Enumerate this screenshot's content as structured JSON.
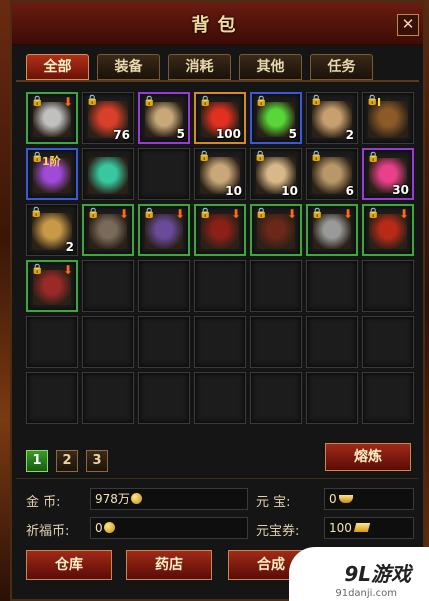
{
  "window": {
    "title": "背包",
    "close_glyph": "✕"
  },
  "tabs": [
    {
      "label": "全部",
      "active": true
    },
    {
      "label": "装备",
      "active": false
    },
    {
      "label": "消耗",
      "active": false
    },
    {
      "label": "其他",
      "active": false
    },
    {
      "label": "任务",
      "active": false
    }
  ],
  "grid": {
    "columns": 7,
    "rows": 6
  },
  "items": [
    {
      "name": "ornate-sword-icon",
      "quality": "green",
      "locked": true,
      "upgrade": true,
      "count": "",
      "badge": "",
      "color": "#c0c0c0"
    },
    {
      "name": "red-potion-vial-icon",
      "quality": "none",
      "locked": true,
      "upgrade": false,
      "count": "76",
      "badge": "",
      "color": "#d8402a"
    },
    {
      "name": "treasure-map-icon",
      "quality": "purple",
      "locked": true,
      "upgrade": false,
      "count": "5",
      "badge": "",
      "color": "#c8a878"
    },
    {
      "name": "red-gem-chest-icon",
      "quality": "orange",
      "locked": true,
      "upgrade": false,
      "count": "100",
      "badge": "",
      "color": "#e03020"
    },
    {
      "name": "green-crystal-icon",
      "quality": "blue",
      "locked": true,
      "upgrade": false,
      "count": "5",
      "badge": "",
      "color": "#58d838"
    },
    {
      "name": "treasure-map-icon",
      "quality": "none",
      "locked": true,
      "upgrade": false,
      "count": "2",
      "badge": "",
      "color": "#c8a070"
    },
    {
      "name": "treasure-chest-icon",
      "quality": "none",
      "locked": true,
      "upgrade": false,
      "count": "",
      "badge": "I",
      "color": "#8a5a28"
    },
    {
      "name": "purple-whip-icon",
      "quality": "blue",
      "locked": true,
      "upgrade": false,
      "count": "",
      "badge": "1阶",
      "color": "#a04ad8"
    },
    {
      "name": "exp-orb-icon",
      "quality": "none",
      "locked": false,
      "upgrade": false,
      "count": "",
      "badge": "",
      "color": "#38c8a0"
    },
    {
      "name": "",
      "quality": "none",
      "locked": false,
      "upgrade": false,
      "count": "",
      "badge": "",
      "color": ""
    },
    {
      "name": "scroll-bundle-icon",
      "quality": "none",
      "locked": true,
      "upgrade": false,
      "count": "10",
      "badge": "",
      "color": "#c8a878"
    },
    {
      "name": "scroll-bundle-icon",
      "quality": "none",
      "locked": true,
      "upgrade": false,
      "count": "10",
      "badge": "",
      "color": "#d8b888"
    },
    {
      "name": "parchment-scroll-icon",
      "quality": "none",
      "locked": true,
      "upgrade": false,
      "count": "6",
      "badge": "",
      "color": "#b89868"
    },
    {
      "name": "heart-potion-icon",
      "quality": "purple",
      "locked": true,
      "upgrade": false,
      "count": "30",
      "badge": "",
      "color": "#e8408a"
    },
    {
      "name": "skill-book-icon",
      "quality": "none",
      "locked": true,
      "upgrade": false,
      "count": "2",
      "badge": "",
      "color": "#c89a48"
    },
    {
      "name": "helmet-icon",
      "quality": "green",
      "locked": true,
      "upgrade": true,
      "count": "",
      "badge": "",
      "color": "#7a6a5a"
    },
    {
      "name": "amulet-icon",
      "quality": "green",
      "locked": true,
      "upgrade": true,
      "count": "",
      "badge": "",
      "color": "#6a4a9a"
    },
    {
      "name": "armor-robe-icon",
      "quality": "green",
      "locked": true,
      "upgrade": true,
      "count": "",
      "badge": "",
      "color": "#8a2018"
    },
    {
      "name": "boots-icon",
      "quality": "green",
      "locked": true,
      "upgrade": true,
      "count": "",
      "badge": "",
      "color": "#6a2818"
    },
    {
      "name": "ornate-sword-icon",
      "quality": "green",
      "locked": true,
      "upgrade": true,
      "count": "",
      "badge": "",
      "color": "#9a9a9a"
    },
    {
      "name": "ring-icon",
      "quality": "green",
      "locked": true,
      "upgrade": true,
      "count": "",
      "badge": "",
      "color": "#b82a18"
    },
    {
      "name": "dagger-icon",
      "quality": "green",
      "locked": true,
      "upgrade": true,
      "count": "",
      "badge": "",
      "color": "#9a2a28"
    }
  ],
  "pager": {
    "pages": [
      "1",
      "2",
      "3"
    ],
    "active_index": 0
  },
  "buttons": {
    "smelt": "熔炼",
    "warehouse": "仓库",
    "pharmacy": "药店",
    "compose": "合成"
  },
  "stats": {
    "gold_label": "金 币:",
    "gold_value": "978万",
    "yuanbao_label": "元 宝:",
    "yuanbao_value": "0",
    "blessing_label": "祈福币:",
    "blessing_value": "0",
    "yuanbao_ticket_label": "元宝券:",
    "yuanbao_ticket_value": "100"
  },
  "watermark": {
    "logo": "9L游戏",
    "url": "91danji.com"
  },
  "colors": {
    "green": "#3aa83a",
    "blue": "#3a5ad8",
    "purple": "#9a3ad8",
    "orange": "#d88a1a",
    "accent": "#a02a18"
  }
}
